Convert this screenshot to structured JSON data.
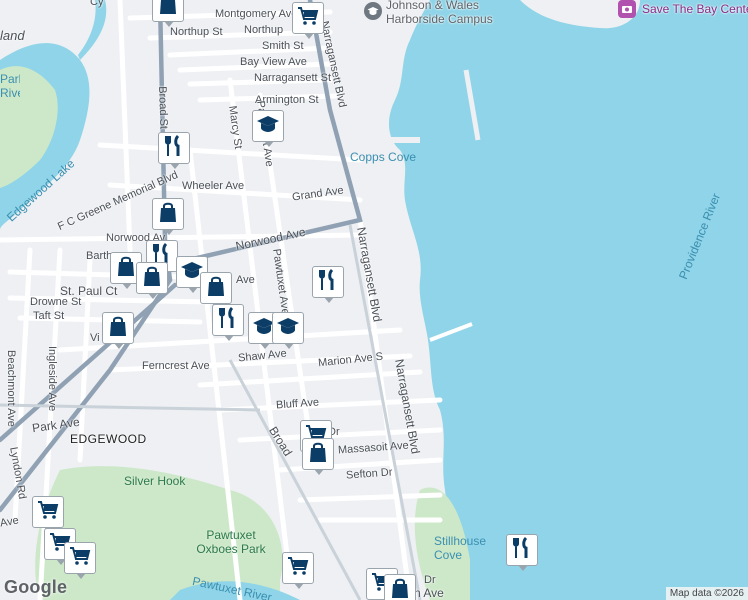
{
  "map": {
    "colors": {
      "water": "#8fd4e8",
      "land": "#eef0f3",
      "park": "#cde8c9",
      "road": "#ffffff",
      "arterial": "#8fa1b3",
      "pin_icon": "#0b3d66"
    },
    "water_labels": [
      {
        "name": "Copps Cove"
      },
      {
        "name": "Providence River"
      },
      {
        "name": "Stillhouse Cove"
      },
      {
        "name": "Edgewood Lake"
      },
      {
        "name": "Park River"
      }
    ],
    "place_labels": [
      {
        "name": "EDGEWOOD"
      },
      {
        "name": "Silver Hook"
      },
      {
        "name": "Pawtuxet Oxboes Park"
      },
      {
        "name": "Pawtuxet River"
      },
      {
        "name": "land"
      }
    ],
    "poi_labels": [
      {
        "name": "Johnson & Wales Harborside Campus",
        "icon": "graduation-cap-icon"
      },
      {
        "name": "Save The Bay Center",
        "icon": "camera-icon"
      }
    ],
    "street_labels": [
      "Montgomery Ave",
      "Northup St",
      "Northup",
      "Smith St",
      "Bay View Ave",
      "Narragansett St",
      "Armington St",
      "Narragansett Blvd",
      "Marcy St",
      "Pawtuxet Ave",
      "Broad St",
      "Wheeler Ave",
      "Grand Ave",
      "F C Greene Memorial Blvd",
      "Norwood Ave",
      "Norwood Av",
      "Barth",
      "St. Paul Ct",
      "Drowne St",
      "Taft St",
      "Ave",
      "Vi",
      "Ferncrest Ave",
      "Shaw Ave",
      "Marion Ave S",
      "Beachmont Ave",
      "Ingleside Ave",
      "Park Ave",
      "Lyndon Rd",
      "Bluff Ave",
      "Broad",
      "Massasoit Ave",
      "Sefton Dr",
      "Narragansett Blvd",
      "Cy",
      "ve",
      "Dr",
      "n Ave"
    ],
    "pins": [
      {
        "type": "grocery",
        "icon": "shopping-cart-icon"
      },
      {
        "type": "shopping",
        "icon": "shopping-bag-icon"
      },
      {
        "type": "school",
        "icon": "graduation-cap-icon"
      },
      {
        "type": "restaurant",
        "icon": "fork-knife-icon"
      },
      {
        "type": "shopping",
        "icon": "shopping-bag-icon"
      },
      {
        "type": "restaurant",
        "icon": "fork-knife-icon"
      },
      {
        "type": "shopping",
        "icon": "shopping-bag-icon"
      },
      {
        "type": "school",
        "icon": "graduation-cap-icon"
      },
      {
        "type": "shopping",
        "icon": "shopping-bag-icon"
      },
      {
        "type": "restaurant",
        "icon": "fork-knife-icon"
      },
      {
        "type": "shopping",
        "icon": "shopping-bag-icon"
      },
      {
        "type": "restaurant",
        "icon": "fork-knife-icon"
      },
      {
        "type": "school",
        "icon": "graduation-cap-icon"
      },
      {
        "type": "school",
        "icon": "graduation-cap-icon"
      },
      {
        "type": "shopping",
        "icon": "shopping-bag-icon"
      },
      {
        "type": "grocery",
        "icon": "shopping-cart-icon"
      },
      {
        "type": "shopping",
        "icon": "shopping-bag-icon"
      },
      {
        "type": "grocery",
        "icon": "shopping-cart-icon"
      },
      {
        "type": "grocery",
        "icon": "shopping-cart-icon"
      },
      {
        "type": "grocery",
        "icon": "shopping-cart-icon"
      },
      {
        "type": "grocery",
        "icon": "shopping-cart-icon"
      },
      {
        "type": "restaurant",
        "icon": "fork-knife-icon"
      },
      {
        "type": "grocery",
        "icon": "shopping-cart-icon"
      },
      {
        "type": "shopping",
        "icon": "shopping-bag-icon"
      }
    ],
    "branding": {
      "logo": "Google",
      "attribution": "Map data ©2026"
    }
  }
}
